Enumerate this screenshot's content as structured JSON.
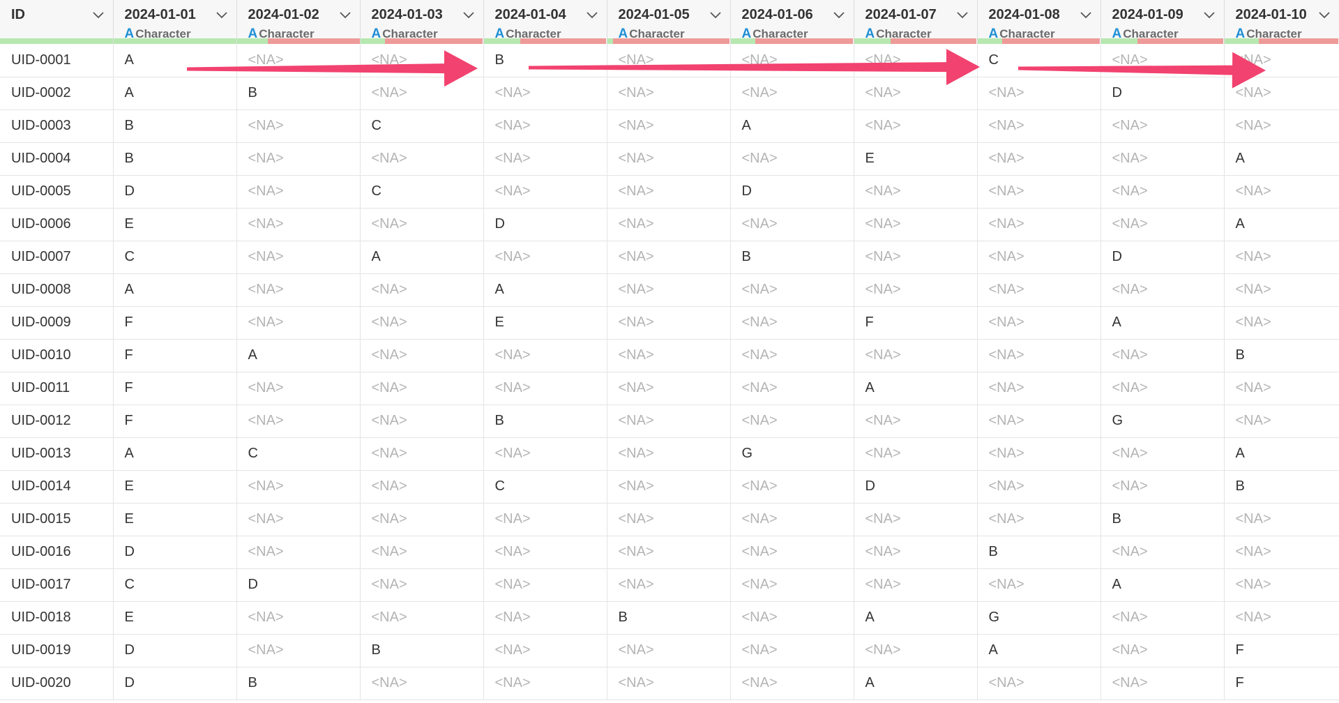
{
  "header": {
    "columns": [
      {
        "name": "ID",
        "type": ""
      },
      {
        "name": "2024-01-01",
        "type": "Character",
        "valid_fraction": 1.0
      },
      {
        "name": "2024-01-02",
        "type": "Character",
        "valid_fraction": 0.25
      },
      {
        "name": "2024-01-03",
        "type": "Character",
        "valid_fraction": 0.2
      },
      {
        "name": "2024-01-04",
        "type": "Character",
        "valid_fraction": 0.3
      },
      {
        "name": "2024-01-05",
        "type": "Character",
        "valid_fraction": 0.05
      },
      {
        "name": "2024-01-06",
        "type": "Character",
        "valid_fraction": 0.2
      },
      {
        "name": "2024-01-07",
        "type": "Character",
        "valid_fraction": 0.3
      },
      {
        "name": "2024-01-08",
        "type": "Character",
        "valid_fraction": 0.2
      },
      {
        "name": "2024-01-09",
        "type": "Character",
        "valid_fraction": 0.3
      },
      {
        "name": "2024-01-10",
        "type": "Character",
        "valid_fraction": 0.3
      }
    ],
    "type_icon": "A",
    "chevron_icon": "chevron-down-icon"
  },
  "rows": [
    [
      "UID-0001",
      "A",
      "<NA>",
      "<NA>",
      "B",
      "<NA>",
      "<NA>",
      "<NA>",
      "C",
      "<NA>",
      "<NA>"
    ],
    [
      "UID-0002",
      "A",
      "B",
      "<NA>",
      "<NA>",
      "<NA>",
      "<NA>",
      "<NA>",
      "<NA>",
      "D",
      "<NA>"
    ],
    [
      "UID-0003",
      "B",
      "<NA>",
      "C",
      "<NA>",
      "<NA>",
      "A",
      "<NA>",
      "<NA>",
      "<NA>",
      "<NA>"
    ],
    [
      "UID-0004",
      "B",
      "<NA>",
      "<NA>",
      "<NA>",
      "<NA>",
      "<NA>",
      "E",
      "<NA>",
      "<NA>",
      "A"
    ],
    [
      "UID-0005",
      "D",
      "<NA>",
      "C",
      "<NA>",
      "<NA>",
      "D",
      "<NA>",
      "<NA>",
      "<NA>",
      "<NA>"
    ],
    [
      "UID-0006",
      "E",
      "<NA>",
      "<NA>",
      "D",
      "<NA>",
      "<NA>",
      "<NA>",
      "<NA>",
      "<NA>",
      "A"
    ],
    [
      "UID-0007",
      "C",
      "<NA>",
      "A",
      "<NA>",
      "<NA>",
      "B",
      "<NA>",
      "<NA>",
      "D",
      "<NA>"
    ],
    [
      "UID-0008",
      "A",
      "<NA>",
      "<NA>",
      "A",
      "<NA>",
      "<NA>",
      "<NA>",
      "<NA>",
      "<NA>",
      "<NA>"
    ],
    [
      "UID-0009",
      "F",
      "<NA>",
      "<NA>",
      "E",
      "<NA>",
      "<NA>",
      "F",
      "<NA>",
      "A",
      "<NA>"
    ],
    [
      "UID-0010",
      "F",
      "A",
      "<NA>",
      "<NA>",
      "<NA>",
      "<NA>",
      "<NA>",
      "<NA>",
      "<NA>",
      "B"
    ],
    [
      "UID-0011",
      "F",
      "<NA>",
      "<NA>",
      "<NA>",
      "<NA>",
      "<NA>",
      "A",
      "<NA>",
      "<NA>",
      "<NA>"
    ],
    [
      "UID-0012",
      "F",
      "<NA>",
      "<NA>",
      "B",
      "<NA>",
      "<NA>",
      "<NA>",
      "<NA>",
      "G",
      "<NA>"
    ],
    [
      "UID-0013",
      "A",
      "C",
      "<NA>",
      "<NA>",
      "<NA>",
      "G",
      "<NA>",
      "<NA>",
      "<NA>",
      "A"
    ],
    [
      "UID-0014",
      "E",
      "<NA>",
      "<NA>",
      "C",
      "<NA>",
      "<NA>",
      "D",
      "<NA>",
      "<NA>",
      "B"
    ],
    [
      "UID-0015",
      "E",
      "<NA>",
      "<NA>",
      "<NA>",
      "<NA>",
      "<NA>",
      "<NA>",
      "<NA>",
      "B",
      "<NA>"
    ],
    [
      "UID-0016",
      "D",
      "<NA>",
      "<NA>",
      "<NA>",
      "<NA>",
      "<NA>",
      "<NA>",
      "B",
      "<NA>",
      "<NA>"
    ],
    [
      "UID-0017",
      "C",
      "D",
      "<NA>",
      "<NA>",
      "<NA>",
      "<NA>",
      "<NA>",
      "<NA>",
      "A",
      "<NA>"
    ],
    [
      "UID-0018",
      "E",
      "<NA>",
      "<NA>",
      "<NA>",
      "B",
      "<NA>",
      "A",
      "G",
      "<NA>",
      "<NA>"
    ],
    [
      "UID-0019",
      "D",
      "<NA>",
      "B",
      "<NA>",
      "<NA>",
      "<NA>",
      "<NA>",
      "A",
      "<NA>",
      "F"
    ],
    [
      "UID-0020",
      "D",
      "B",
      "<NA>",
      "<NA>",
      "<NA>",
      "<NA>",
      "A",
      "<NA>",
      "<NA>",
      "F"
    ]
  ],
  "annotations": {
    "arrow_color": "#f2426f",
    "arrows_count": 3
  }
}
